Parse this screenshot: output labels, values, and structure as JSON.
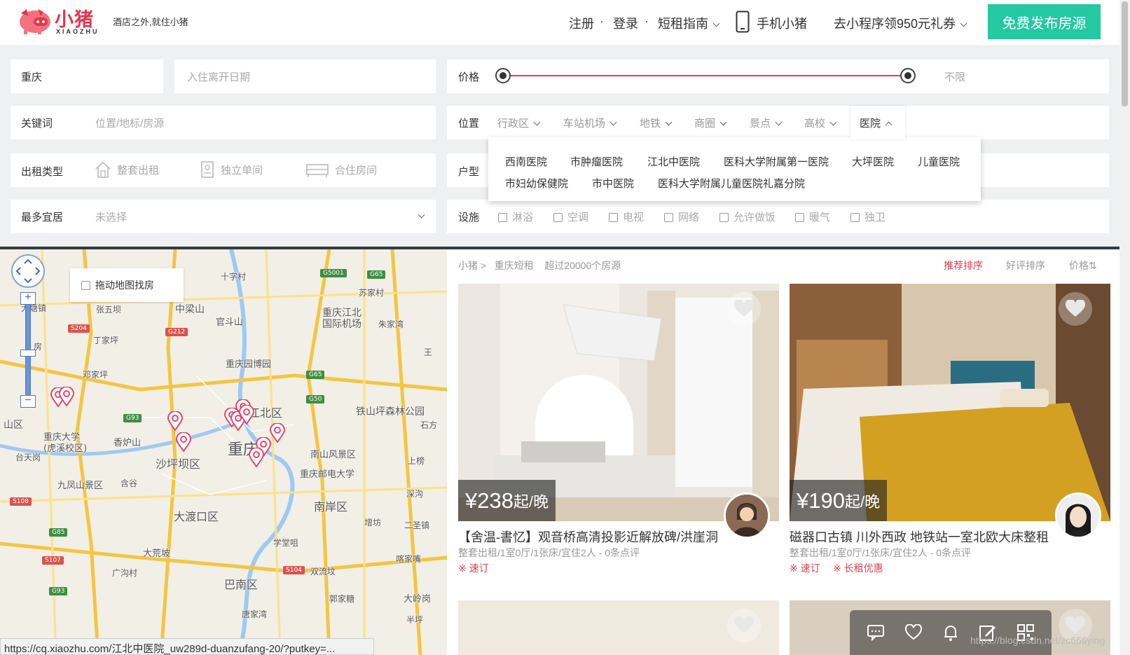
{
  "header": {
    "logo_cn": "小猪",
    "logo_en": "XIAOZHU",
    "slogan": "酒店之外,就住小猪",
    "nav": {
      "register": "注册",
      "login": "登录",
      "guide": "短租指南",
      "mobile": "手机小猪",
      "miniprogram": "去小程序领950元礼券",
      "sep": "·"
    },
    "publish_button": "免费发布房源"
  },
  "search": {
    "city": "重庆",
    "date_placeholder": "入住离开日期",
    "keyword_label": "关键词",
    "keyword_placeholder": "位置/地标/房源",
    "rent_type_label": "出租类型",
    "rent_types": [
      "整套出租",
      "独立单间",
      "合住房间"
    ],
    "guests_label": "最多宜居",
    "guests_value": "未选择"
  },
  "filters": {
    "price_label": "价格",
    "price_max": "不限",
    "location_label": "位置",
    "location_tabs": [
      "行政区",
      "车站机场",
      "地铁",
      "商圈",
      "景点",
      "高校",
      "医院"
    ],
    "room_label": "户型",
    "facility_label": "设施",
    "facilities": [
      "淋浴",
      "空调",
      "电视",
      "网络",
      "允许做饭",
      "暖气",
      "独卫"
    ]
  },
  "hospital_dropdown": {
    "row1": [
      "西南医院",
      "市肿瘤医院",
      "江北中医院",
      "医科大学附属第一医院",
      "大坪医院",
      "儿童医院"
    ],
    "row2": [
      "市妇幼保健院",
      "市中医院",
      "医科大学附属儿童医院礼嘉分院"
    ]
  },
  "map": {
    "drag_search": "拖动地图找房",
    "labels": [
      {
        "t": "十字村"
      },
      {
        "t": "苏家村"
      },
      {
        "t": "大塘镇"
      },
      {
        "t": "张五坝"
      },
      {
        "t": "中梁山"
      },
      {
        "t": "官斗山"
      },
      {
        "t": "重庆江北"
      },
      {
        "t": "国际机场"
      },
      {
        "t": "朱家湾"
      },
      {
        "t": "丁家坪"
      },
      {
        "t": "重庆园博园"
      },
      {
        "t": "邓家坪"
      },
      {
        "t": "铁山坪森林公园"
      },
      {
        "t": "江北区"
      },
      {
        "t": "山区"
      },
      {
        "t": "重庆大学"
      },
      {
        "t": "(虎溪校区)"
      },
      {
        "t": "香炉山"
      },
      {
        "t": "重庆"
      },
      {
        "t": "石方"
      },
      {
        "t": "台天岗"
      },
      {
        "t": "沙坪坝区"
      },
      {
        "t": "南山风景区"
      },
      {
        "t": "上榜"
      },
      {
        "t": "九凤山景区"
      },
      {
        "t": "含谷"
      },
      {
        "t": "重庆邮电大学"
      },
      {
        "t": "大渡口区"
      },
      {
        "t": "南岸区"
      },
      {
        "t": "深沟"
      },
      {
        "t": "增坊"
      },
      {
        "t": "二圣镇"
      },
      {
        "t": "学堂咀"
      },
      {
        "t": "大荒坡"
      },
      {
        "t": "喀家嘴"
      },
      {
        "t": "广沟村"
      },
      {
        "t": "双流坟"
      },
      {
        "t": "巴南区"
      },
      {
        "t": "郭家糖"
      },
      {
        "t": "大岭岗"
      },
      {
        "t": "唐家湾"
      },
      {
        "t": "半坪"
      },
      {
        "t": "王"
      },
      {
        "t": "房"
      }
    ],
    "highways": [
      "G5001",
      "G65",
      "S204",
      "G212",
      "G65",
      "G50",
      "G93",
      "S108",
      "G85",
      "S107",
      "S104",
      "G93"
    ]
  },
  "listing": {
    "breadcrumb": [
      "小猪",
      "重庆短租",
      "超过20000个房源"
    ],
    "sorts": [
      "推荐排序",
      "好评排序",
      "价格⇅"
    ],
    "cards": [
      {
        "price": "¥238",
        "unit": "起/晚",
        "title": "【舍温-書忆】观音桥高清投影近解放碑/洪崖洞",
        "meta": "整套出租/1室0厅/1张床/宜住2人 - 0条点评",
        "tags": [
          "※ 速订"
        ]
      },
      {
        "price": "¥190",
        "unit": "起/晚",
        "title": "磁器口古镇 川外西政 地铁站一室北欧大床整租",
        "meta": "整套出租/1室0厅/1张床/宜住2人 - 0条点评",
        "tags": [
          "※ 速订",
          "※ 长租优惠"
        ]
      }
    ]
  },
  "status_url": "https://cq.xiaozhu.com/江北中医院_uw289d-duanzufang-20/?putkey=...",
  "watermark": "https://blog.csdn.net/zc666ying",
  "colors": {
    "brand_green": "#24c8a1",
    "brand_red": "#e0404d"
  }
}
